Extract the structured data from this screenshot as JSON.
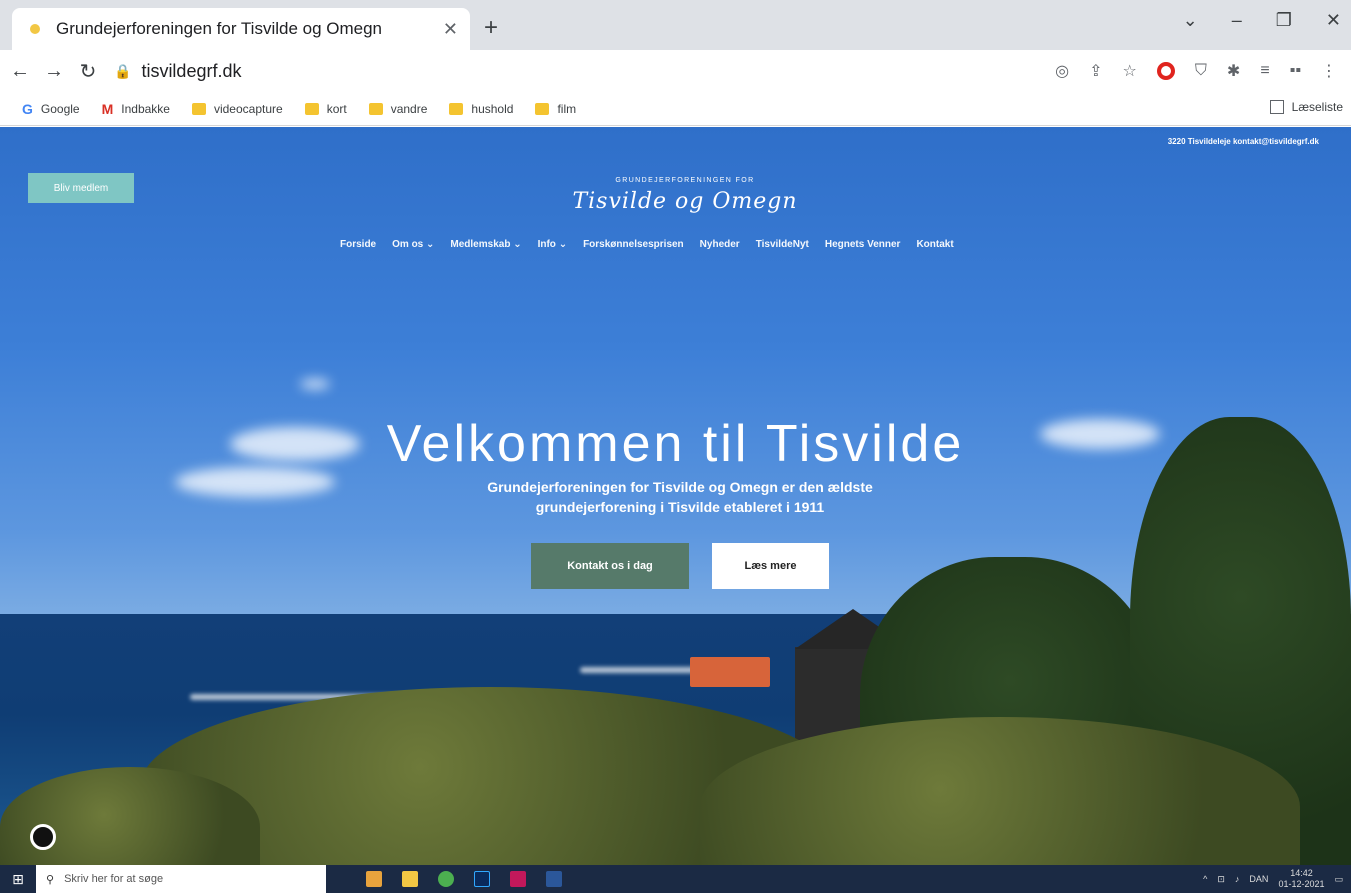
{
  "browser": {
    "tab_title": "Grundejerforeningen for Tisvilde og Omegn",
    "url": "tisvildegrf.dk",
    "bookmarks": [
      "Google",
      "Indbakke",
      "videocapture",
      "kort",
      "vandre",
      "hushold",
      "film"
    ],
    "reading_list": "Læseliste"
  },
  "site": {
    "contact_top": "3220 Tisvildeleje  kontakt@tisvildegrf.dk",
    "join_button": "Bliv medlem",
    "logo_small": "GRUNDEJERFORENINGEN FOR",
    "logo_script": "Tisvilde og Omegn",
    "menu": [
      "Forside",
      "Om os ⌄",
      "Medlemskab ⌄",
      "Info ⌄",
      "Forskønnelsesprisen",
      "Nyheder",
      "TisvildeNyt",
      "Hegnets Venner",
      "Kontakt"
    ],
    "hero_title": "Velkommen til Tisvilde",
    "hero_sub": "Grundejerforeningen for Tisvilde og Omegn er den ældste grundejerforening i Tisvilde etableret i 1911",
    "btn_contact": "Kontakt os i dag",
    "btn_read": "Læs mere"
  },
  "taskbar": {
    "search_placeholder": "Skriv her for at søge",
    "language": "DAN",
    "time": "14:42",
    "date": "01-12-2021"
  }
}
